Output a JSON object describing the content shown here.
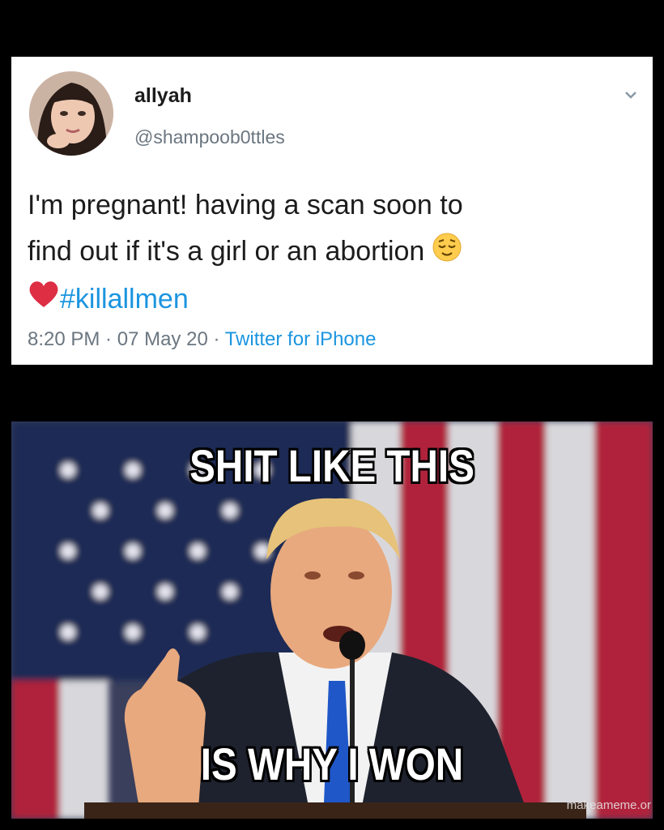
{
  "tweet": {
    "display_name": "allyah",
    "handle": "@shampoob0ttles",
    "text_line1": "I'm pregnant! having a scan soon to",
    "text_line2": "find out if it's a girl or an abortion",
    "hashtag": "#killallmen",
    "time": "8:20 PM",
    "date": "07 May 20",
    "separator": " · ",
    "source": "Twitter for iPhone",
    "emoji_1": "relieved-face-emoji",
    "emoji_2": "red-heart-emoji"
  },
  "meme": {
    "top_text": "SHIT LIKE THIS",
    "bottom_text": "IS WHY I WON",
    "watermark": "makeameme.or"
  },
  "colors": {
    "background": "#000000",
    "tweet_bg": "#ffffff",
    "link_blue": "#1b95e0",
    "meta_gray": "#6b7680",
    "flag_red": "#b0233a",
    "flag_blue": "#1f2a55"
  }
}
